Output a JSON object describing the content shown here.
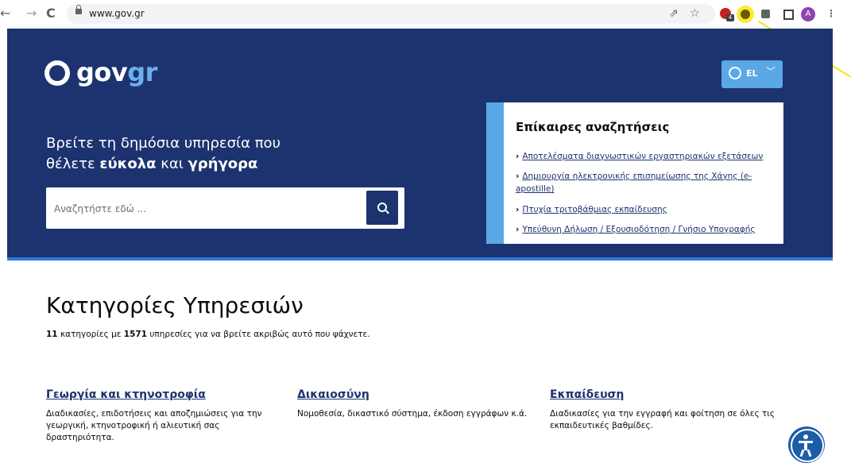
{
  "browser": {
    "back": "←",
    "forward": "→",
    "reload": "C",
    "url": "www.gov.gr",
    "share_icon": "⇗",
    "star_icon": "☆",
    "ext_badge": "4",
    "avatar": "A",
    "menu": "⋮"
  },
  "header": {
    "logo_gov": "gov",
    "logo_gr": "gr",
    "lang": "EL",
    "lang_chevron": "﹀"
  },
  "hero": {
    "line1": "Βρείτε τη δημόσια υπηρεσία που",
    "line2_prefix": "θέλετε ",
    "line2_bold1": "εύκολα",
    "line2_mid": " και ",
    "line2_bold2": "γρήγορα",
    "search_placeholder": "Αναζητήστε εδώ ..."
  },
  "trending": {
    "title": "Επίκαιρες αναζητήσεις",
    "arrow": "›",
    "links": [
      "Αποτελέσματα διαγνωστικών εργαστηριακών εξετάσεων",
      "Δημιουργία ηλεκτρονικής επισημείωσης της Χάγης (e-apostille)",
      "Πτυχία τριτοβάθμιας εκπαίδευσης",
      "Υπεύθυνη Δήλωση / Εξουσιοδότηση / Γνήσιο Υπογραφής"
    ]
  },
  "categories": {
    "heading": "Κατηγορίες Υπηρεσιών",
    "count_categories": "11",
    "text_mid": " κατηγορίες με ",
    "count_services": "1571",
    "text_end": " υπηρεσίες για να βρείτε ακριβώς αυτό που ψάχνετε.",
    "items": [
      {
        "title": "Γεωργία και κτηνοτροφία",
        "desc": "Διαδικασίες, επιδοτήσεις και αποζημιώσεις για την γεωργική, κτηνοτροφική ή αλιευτική σας δραστηριότητα."
      },
      {
        "title": "Δικαιοσύνη",
        "desc": "Νομοθεσία, δικαστικό σύστημα, έκδοση εγγράφων κ.ά."
      },
      {
        "title": "Εκπαίδευση",
        "desc": "Διαδικασίες για την εγγραφή και φοίτηση σε όλες τις εκπαιδευτικές βαθμίδες."
      }
    ]
  },
  "colors": {
    "brand_navy": "#1d3370",
    "accent_blue": "#5aa9e6",
    "annotation_yellow": "#f2e41e"
  }
}
